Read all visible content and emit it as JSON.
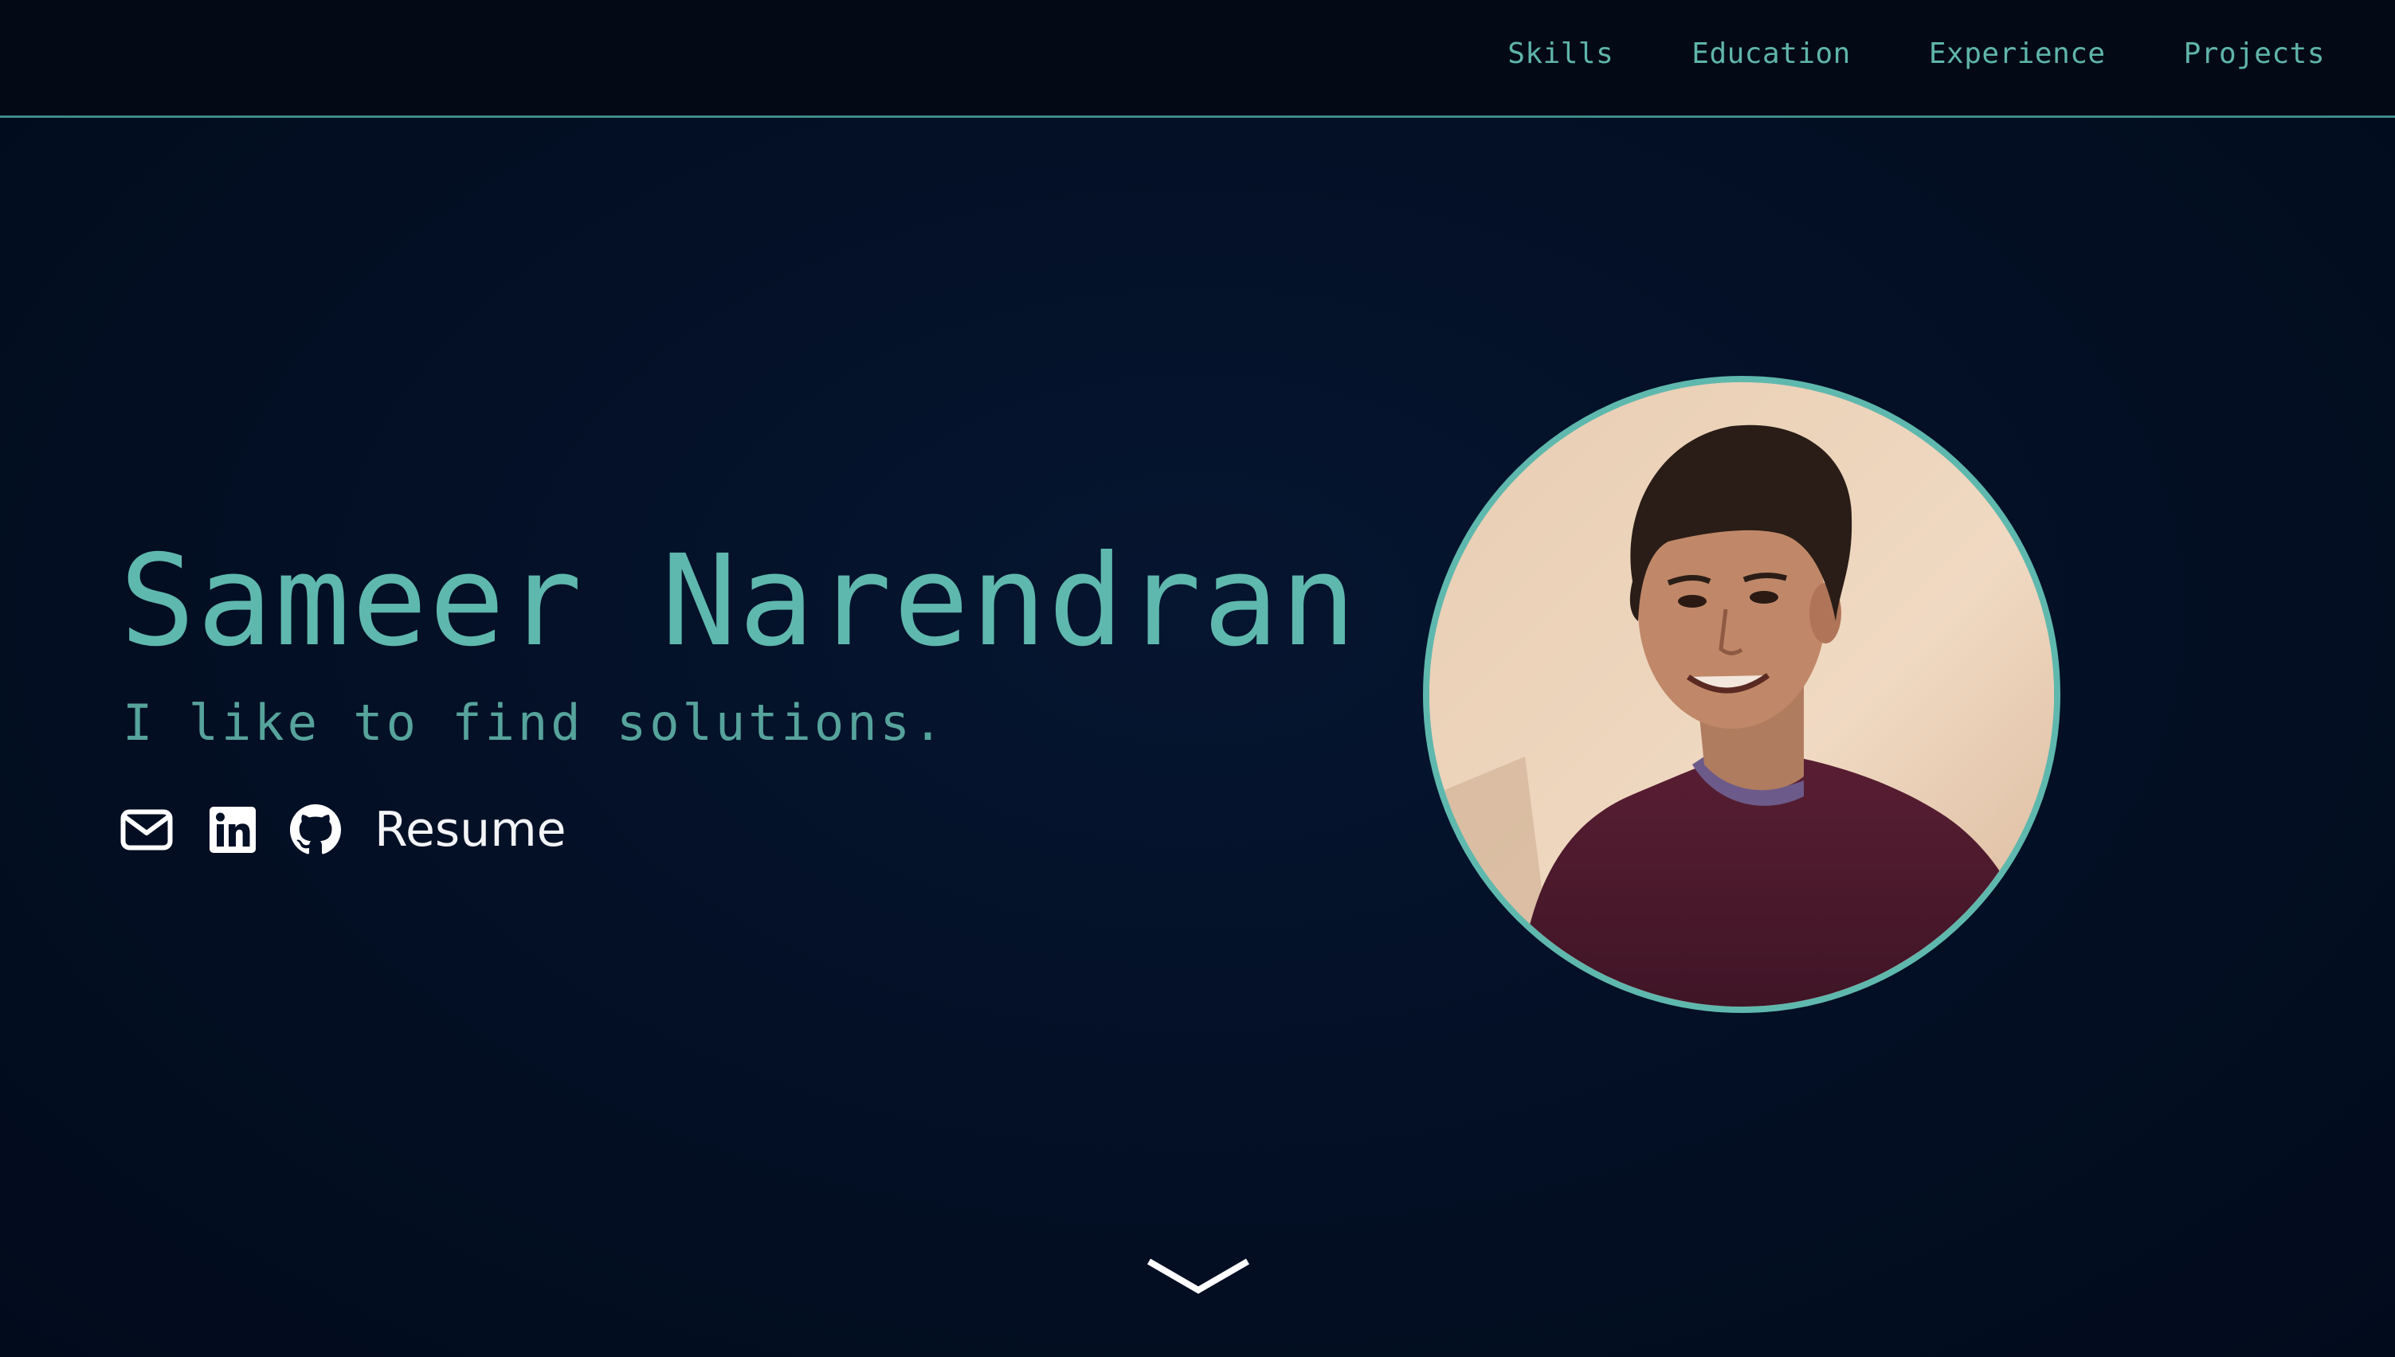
{
  "nav": {
    "links": [
      {
        "label": "Skills"
      },
      {
        "label": "Education"
      },
      {
        "label": "Experience"
      },
      {
        "label": "Projects"
      }
    ]
  },
  "hero": {
    "name": "Sameer Narendran",
    "tagline": "I like to find solutions.",
    "social": {
      "email_icon": "envelope-icon",
      "linkedin_icon": "linkedin-icon",
      "github_icon": "github-icon",
      "resume_label": "Resume"
    }
  },
  "portrait": {
    "icon": "profile-photo"
  },
  "scroll": {
    "icon": "chevron-down-icon"
  },
  "colors": {
    "background": "#031026",
    "accent": "#5fb8ad",
    "nav_text": "#5fb5aa",
    "nav_border": "#3f8a88",
    "resume_text": "#f2f4f6"
  }
}
